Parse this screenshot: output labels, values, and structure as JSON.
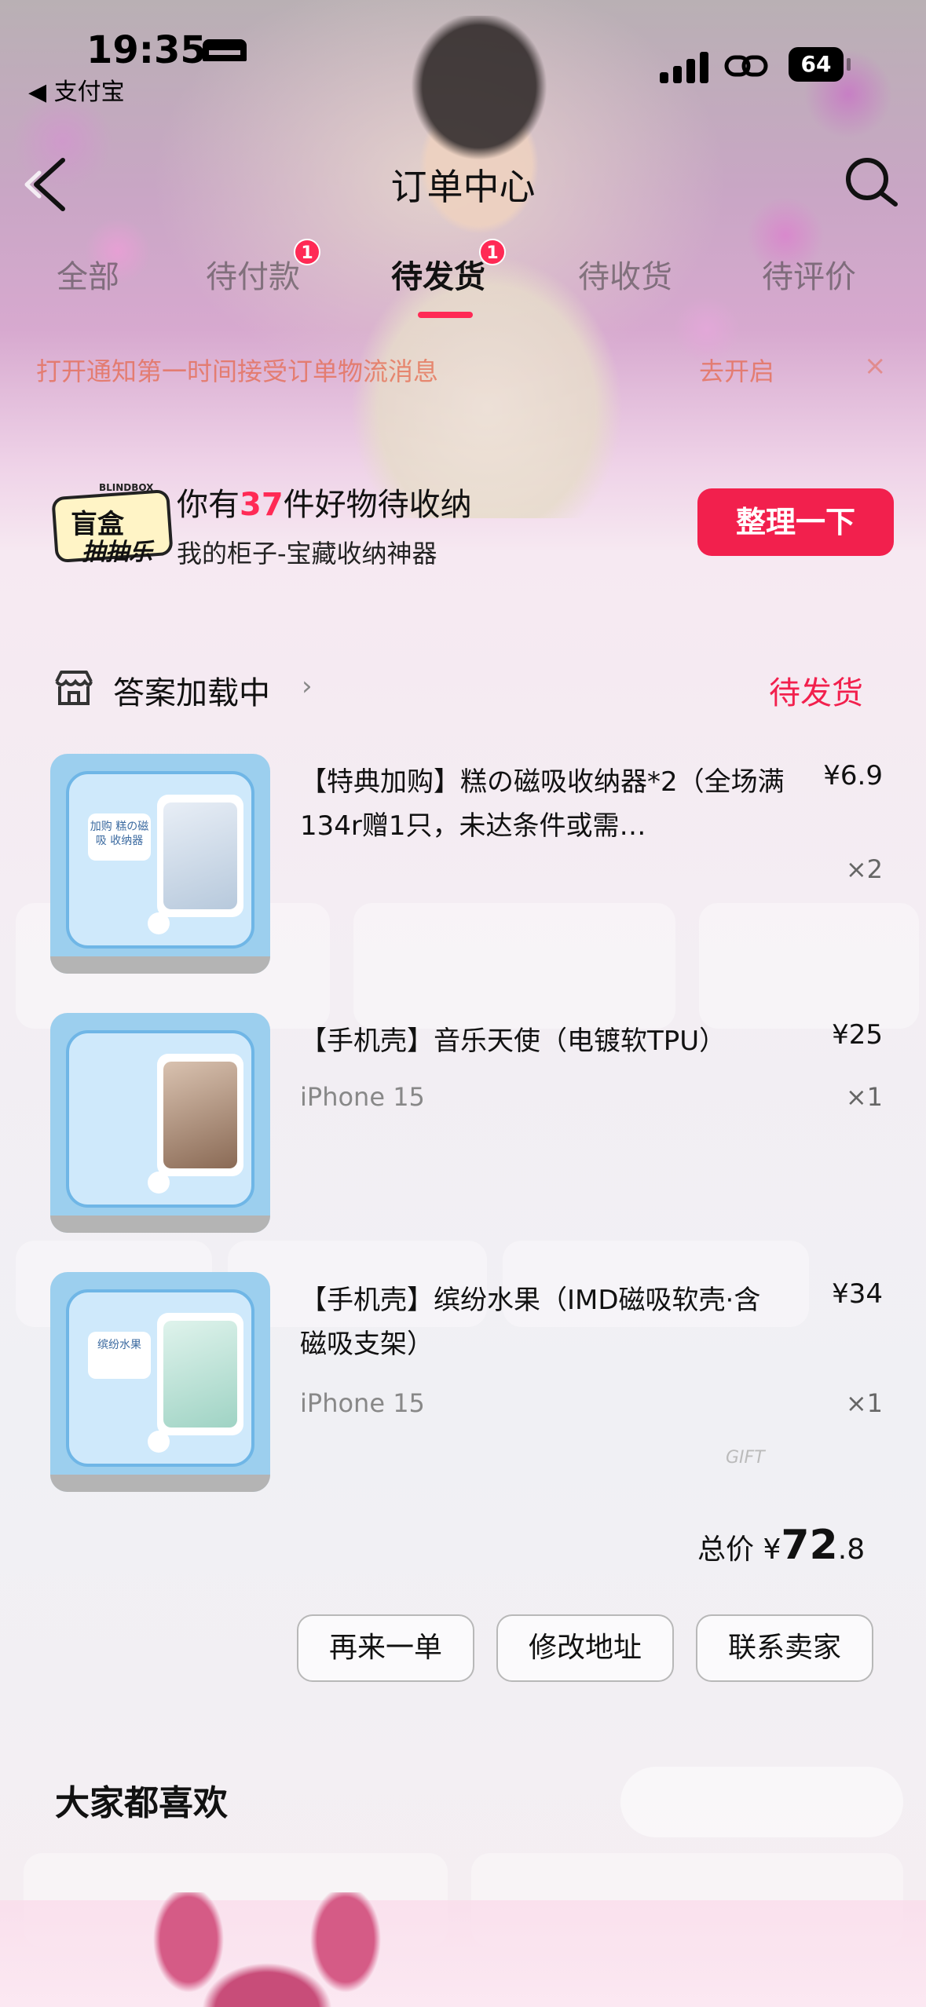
{
  "status_bar": {
    "time": "19:35",
    "back_app": "◀ 支付宝",
    "battery": "64"
  },
  "navbar": {
    "title": "订单中心"
  },
  "tabs": [
    {
      "label": "全部",
      "badge": ""
    },
    {
      "label": "待付款",
      "badge": "1"
    },
    {
      "label": "待发货",
      "badge": "1"
    },
    {
      "label": "待收货",
      "badge": ""
    },
    {
      "label": "待评价",
      "badge": ""
    }
  ],
  "notice": {
    "message": "打开通知第一时间接受订单物流消息",
    "action": "去开启",
    "close": "×"
  },
  "banner": {
    "logo_line1": "盲盒",
    "logo_line2": "抽抽乐",
    "logo_tag": "BLINDBOX",
    "headline_pre": "你有",
    "headline_num": "37",
    "headline_post": "件好物待收纳",
    "sub": "我的柜子-宝藏收纳神器",
    "button": "整理一下"
  },
  "order": {
    "shop_name": "答案加载中",
    "status": "待发货",
    "items": [
      {
        "name": "【特典加购】糕の磁吸收纳器*2（全场满134r赠1只，未达条件或需…",
        "price": "¥6.9",
        "spec": "",
        "qty": "×2",
        "thumb_label": "加购 糕の磁吸 收纳器"
      },
      {
        "name": "【手机壳】音乐天使（电镀软TPU）",
        "price": "¥25",
        "spec": "iPhone 15",
        "qty": "×1",
        "thumb_label": ""
      },
      {
        "name": "【手机壳】缤纷水果（IMD磁吸软壳·含磁吸支架）",
        "price": "¥34",
        "spec": "iPhone 15",
        "qty": "×1",
        "thumb_label": "缤纷水果"
      }
    ],
    "total_label": "总价",
    "total_currency": "¥",
    "total_int": "72",
    "total_dec": ".8",
    "gift_text": "GIFT",
    "actions": [
      "再来一单",
      "修改地址",
      "联系卖家"
    ]
  },
  "section": {
    "title": "大家都喜欢"
  },
  "colors": {
    "accent": "#f2204d",
    "notice": "#e66446",
    "badge": "#ff2a55",
    "thumb_bg": "#9ccfee"
  },
  "icons": {
    "back": "chevron-left-icon",
    "search": "search-icon",
    "shop": "shop-icon",
    "signal": "signal-icon",
    "link": "link-icon",
    "bed": "bed-icon"
  }
}
